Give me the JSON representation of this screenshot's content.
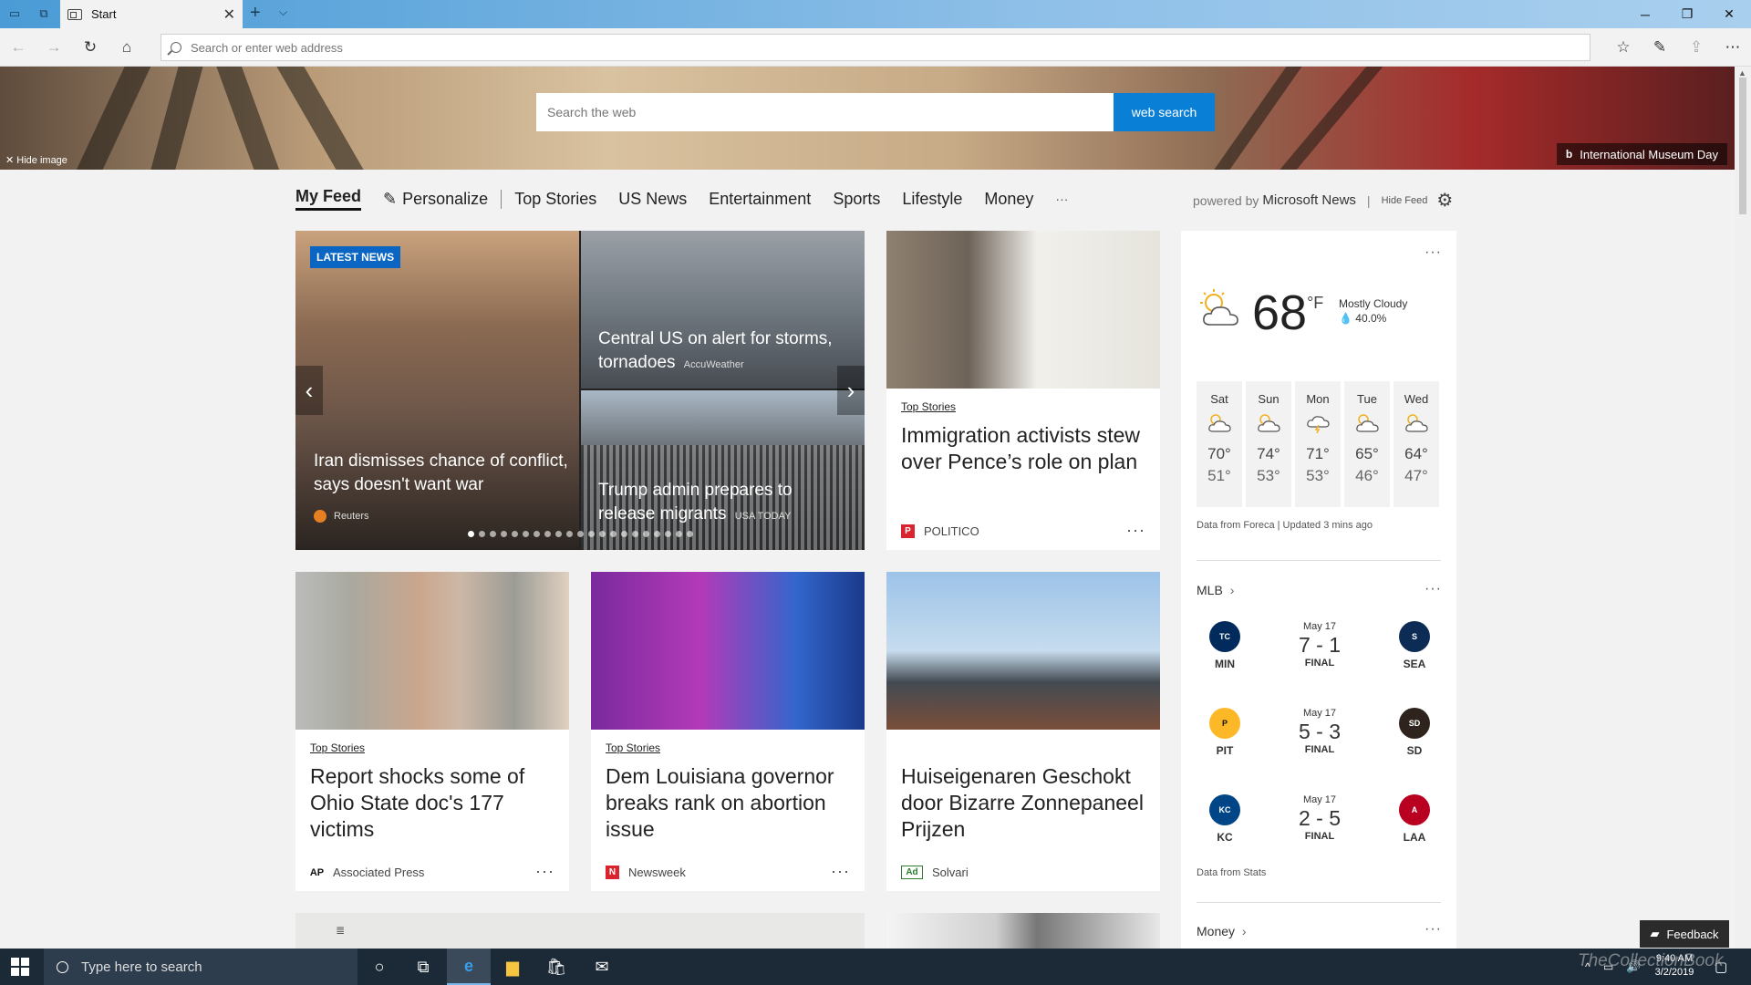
{
  "browser": {
    "tab_title": "Start",
    "address_placeholder": "Search or enter web address",
    "icons": {
      "tab_actions": [
        "tab-preview-icon",
        "set-aside-tabs-icon"
      ],
      "nav": [
        "back-icon",
        "forward-icon",
        "refresh-icon",
        "home-icon"
      ],
      "right": [
        "favorites-icon",
        "notes-icon",
        "share-icon",
        "more-icon"
      ]
    }
  },
  "hero": {
    "search_placeholder": "Search the web",
    "search_button": "web search",
    "hide_image": "Hide image",
    "image_caption": "International Museum Day"
  },
  "feed_nav": {
    "items": [
      "My Feed",
      "Personalize",
      "Top Stories",
      "US News",
      "Entertainment",
      "Sports",
      "Lifestyle",
      "Money",
      "···"
    ],
    "powered_by_prefix": "powered by",
    "powered_by_brand": "Microsoft News",
    "hide_feed": "Hide Feed"
  },
  "carousel": {
    "badge": "LATEST NEWS",
    "main_headline": "Iran dismisses chance of conflict, says doesn't want war",
    "main_source": "Reuters",
    "top_right_headline": "Central US on alert for storms, tornadoes",
    "top_right_source": "AccuWeather",
    "bottom_right_headline": "Trump admin prepares to release migrants",
    "bottom_right_source": "USA TODAY"
  },
  "stories": [
    {
      "category": "Top Stories",
      "headline": "Immigration activists stew over Pence’s role on plan",
      "source": "POLITICO",
      "logo": "P",
      "logo_color": "#d9232e"
    },
    {
      "category": "Top Stories",
      "headline": "Report shocks some of Ohio State doc's 177 victims",
      "source": "Associated Press",
      "logo": "AP",
      "logo_color": "#e8282e"
    },
    {
      "category": "Top Stories",
      "headline": "Dem Louisiana governor breaks rank on abortion issue",
      "source": "Newsweek",
      "logo": "N",
      "logo_color": "#d9232e"
    },
    {
      "category": "",
      "headline": "Huiseigenaren Geschokt door Bizarre Zonnepaneel Prijzen",
      "source": "Solvari",
      "logo": "Ad",
      "logo_color": "#2e7d32"
    }
  ],
  "weather": {
    "temp": "68",
    "unit": "°F",
    "condition": "Mostly Cloudy",
    "precip": "40.0%",
    "forecast": [
      {
        "day": "Sat",
        "hi": "70°",
        "lo": "51°",
        "icon": "partly-cloudy-icon"
      },
      {
        "day": "Sun",
        "hi": "74°",
        "lo": "53°",
        "icon": "partly-cloudy-icon"
      },
      {
        "day": "Mon",
        "hi": "71°",
        "lo": "53°",
        "icon": "thunderstorm-icon"
      },
      {
        "day": "Tue",
        "hi": "65°",
        "lo": "46°",
        "icon": "partly-cloudy-icon"
      },
      {
        "day": "Wed",
        "hi": "64°",
        "lo": "47°",
        "icon": "partly-cloudy-icon"
      }
    ],
    "credit": "Data from Foreca | Updated 3 mins ago"
  },
  "mlb": {
    "title": "MLB",
    "games": [
      {
        "date": "May 17",
        "score": "7 - 1",
        "status": "FINAL",
        "home": "MIN",
        "away": "SEA",
        "home_color": "#002b5c",
        "away_color": "#0c2c56"
      },
      {
        "date": "May 17",
        "score": "5 - 3",
        "status": "FINAL",
        "home": "PIT",
        "away": "SD",
        "home_color": "#fdb827",
        "away_color": "#2f241d"
      },
      {
        "date": "May 17",
        "score": "2 - 5",
        "status": "FINAL",
        "home": "KC",
        "away": "LAA",
        "home_color": "#004687",
        "away_color": "#ba0021"
      }
    ],
    "credit": "Data from Stats"
  },
  "money": {
    "title": "Money"
  },
  "feedback": "Feedback",
  "taskbar": {
    "search_placeholder": "Type here to search",
    "time": "9:40 AM",
    "date": "3/2/2019"
  },
  "watermark": "TheCollectionBook"
}
